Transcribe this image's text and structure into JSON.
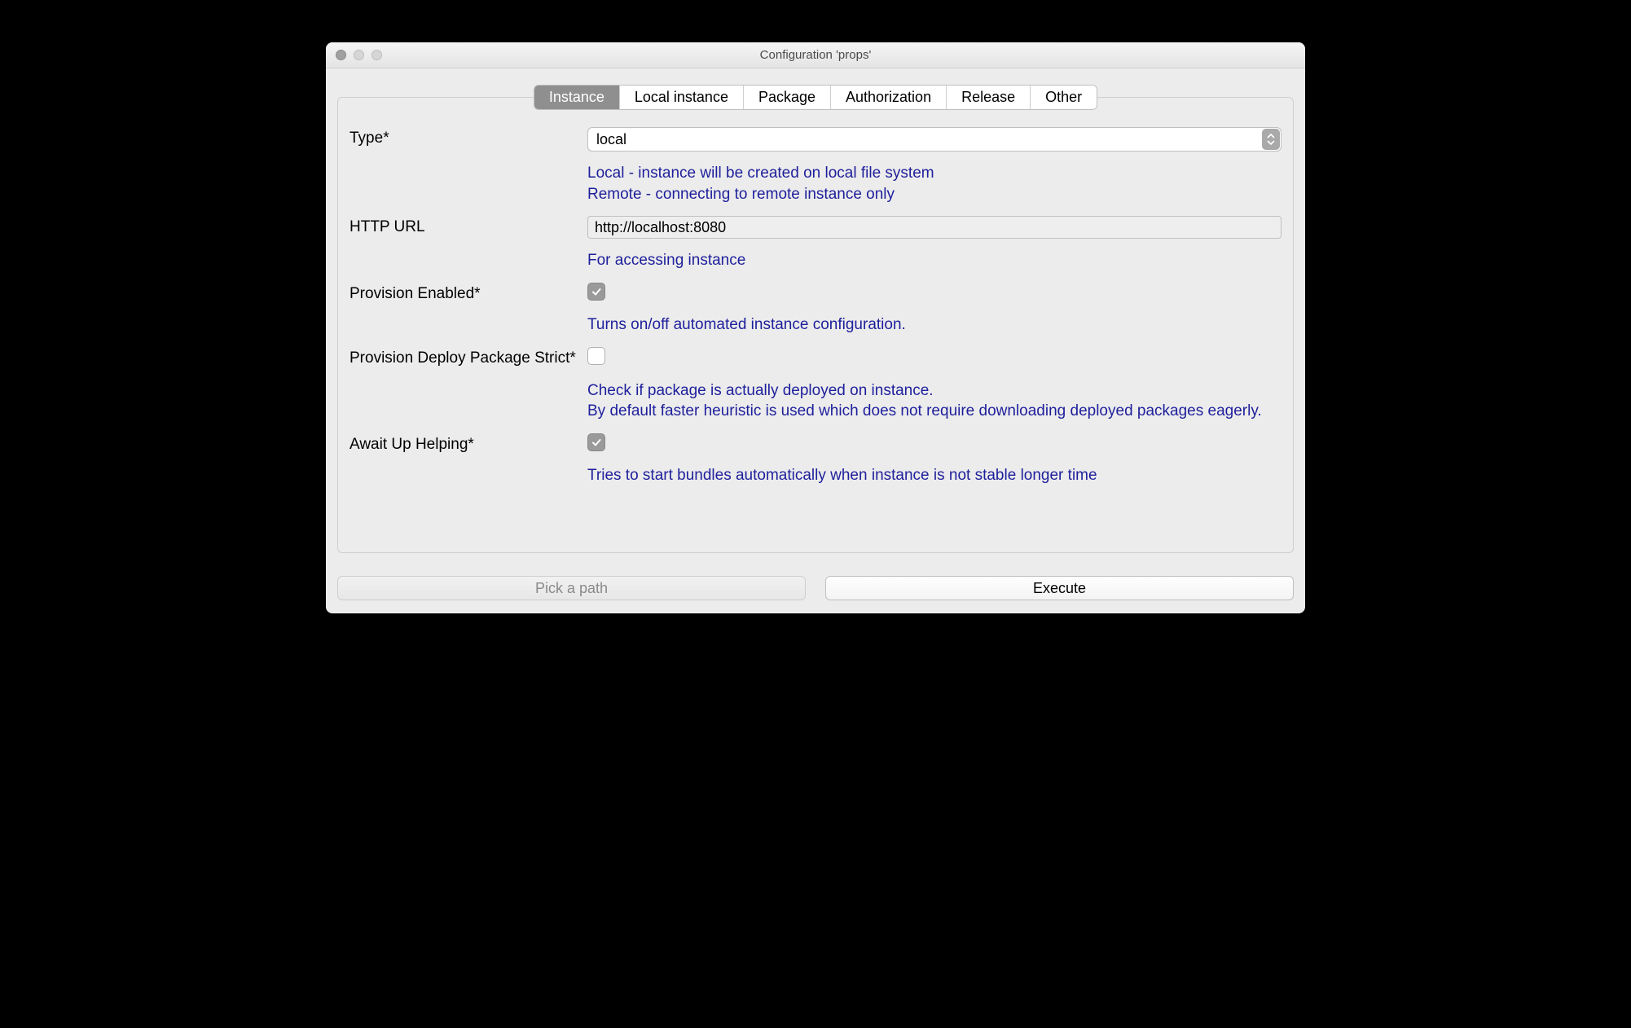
{
  "window": {
    "title": "Configuration 'props'"
  },
  "tabs": [
    {
      "label": "Instance",
      "active": true
    },
    {
      "label": "Local instance",
      "active": false
    },
    {
      "label": "Package",
      "active": false
    },
    {
      "label": "Authorization",
      "active": false
    },
    {
      "label": "Release",
      "active": false
    },
    {
      "label": "Other",
      "active": false
    }
  ],
  "form": {
    "type": {
      "label": "Type*",
      "value": "local",
      "help1": "Local - instance will be created on local file system",
      "help2": "Remote - connecting to remote instance only"
    },
    "httpUrl": {
      "label": "HTTP URL",
      "value": "http://localhost:8080",
      "help": "For accessing instance"
    },
    "provisionEnabled": {
      "label": "Provision Enabled*",
      "checked": true,
      "help": "Turns on/off automated instance configuration."
    },
    "provisionDeployPackageStrict": {
      "label": "Provision Deploy Package Strict*",
      "checked": false,
      "help1": "Check if package is actually deployed on instance.",
      "help2": "By default faster heuristic is used which does not require downloading deployed packages eagerly."
    },
    "awaitUpHelping": {
      "label": "Await Up Helping*",
      "checked": true,
      "help": "Tries to start bundles automatically when instance is not stable longer time"
    }
  },
  "buttons": {
    "pickPath": "Pick a path",
    "execute": "Execute"
  }
}
